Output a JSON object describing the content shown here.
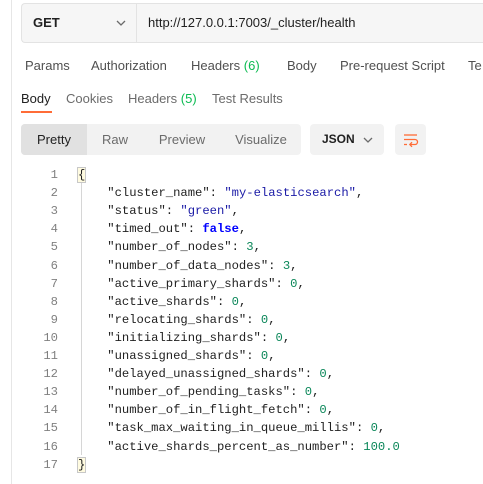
{
  "request": {
    "method": "GET",
    "url": "http://127.0.0.1:7003/_cluster/health"
  },
  "request_tabs": [
    {
      "label": "Params"
    },
    {
      "label": "Authorization"
    },
    {
      "label": "Headers",
      "count": "(6)"
    },
    {
      "label": "Body"
    },
    {
      "label": "Pre-request Script"
    },
    {
      "label": "Te"
    }
  ],
  "response_tabs": [
    {
      "label": "Body"
    },
    {
      "label": "Cookies"
    },
    {
      "label": "Headers",
      "count": "(5)"
    },
    {
      "label": "Test Results"
    }
  ],
  "format_buttons": [
    "Pretty",
    "Raw",
    "Preview",
    "Visualize"
  ],
  "language": "JSON",
  "colors": {
    "accent": "#ff6c37",
    "count_green": "#0cbb52",
    "json_string": "#1a1aa6",
    "json_number": "#098658",
    "json_boolean": "#0000ff"
  },
  "icons": {
    "method_dropdown": "chevron-down-icon",
    "language_dropdown": "chevron-down-icon",
    "wrap": "wrap-lines-icon"
  },
  "response_body": {
    "line_numbers": [
      "1",
      "2",
      "3",
      "4",
      "5",
      "6",
      "7",
      "8",
      "9",
      "10",
      "11",
      "12",
      "13",
      "14",
      "15",
      "16",
      "17"
    ],
    "open_brace": "{",
    "close_brace": "}",
    "fields": [
      {
        "key": "\"cluster_name\"",
        "value": "\"my-elasticsearch\"",
        "type": "string"
      },
      {
        "key": "\"status\"",
        "value": "\"green\"",
        "type": "string"
      },
      {
        "key": "\"timed_out\"",
        "value": "false",
        "type": "boolean"
      },
      {
        "key": "\"number_of_nodes\"",
        "value": "3",
        "type": "number"
      },
      {
        "key": "\"number_of_data_nodes\"",
        "value": "3",
        "type": "number"
      },
      {
        "key": "\"active_primary_shards\"",
        "value": "0",
        "type": "number"
      },
      {
        "key": "\"active_shards\"",
        "value": "0",
        "type": "number"
      },
      {
        "key": "\"relocating_shards\"",
        "value": "0",
        "type": "number"
      },
      {
        "key": "\"initializing_shards\"",
        "value": "0",
        "type": "number"
      },
      {
        "key": "\"unassigned_shards\"",
        "value": "0",
        "type": "number"
      },
      {
        "key": "\"delayed_unassigned_shards\"",
        "value": "0",
        "type": "number"
      },
      {
        "key": "\"number_of_pending_tasks\"",
        "value": "0",
        "type": "number"
      },
      {
        "key": "\"number_of_in_flight_fetch\"",
        "value": "0",
        "type": "number"
      },
      {
        "key": "\"task_max_waiting_in_queue_millis\"",
        "value": "0",
        "type": "number"
      },
      {
        "key": "\"active_shards_percent_as_number\"",
        "value": "100.0",
        "type": "number"
      }
    ]
  }
}
